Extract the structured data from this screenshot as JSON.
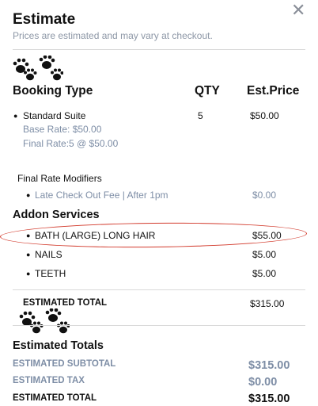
{
  "dialog": {
    "title": "Estimate",
    "subtitle": "Prices are estimated and may vary at checkout.",
    "close_icon": "close-icon"
  },
  "booking": {
    "headers": {
      "type": "Booking Type",
      "qty": "QTY",
      "price": "Est.Price"
    },
    "item": {
      "name": "Standard Suite",
      "qty": "5",
      "price": "$50.00",
      "base_rate": "Base Rate: $50.00",
      "final_rate": "Final Rate:5 @ $50.00"
    },
    "modifiers_title": "Final Rate Modifiers",
    "modifiers": [
      {
        "label": "Late Check Out Fee | After 1pm",
        "price": "$0.00"
      }
    ]
  },
  "addons": {
    "title": "Addon Services",
    "items": [
      {
        "name": "BATH (LARGE) LONG HAIR",
        "price": "$55.00",
        "highlighted": true
      },
      {
        "name": "NAILS",
        "price": "$5.00"
      },
      {
        "name": "TEETH",
        "price": "$5.00"
      }
    ]
  },
  "estimated_total": {
    "label": "ESTIMATED TOTAL",
    "value": "$315.00"
  },
  "totals": {
    "title": "Estimated Totals",
    "subtotal_label": "ESTIMATED SUBTOTAL",
    "subtotal_value": "$315.00",
    "tax_label": "ESTIMATED TAX",
    "tax_value": "$0.00",
    "total_label": "ESTIMATED TOTAL",
    "total_value": "$315.00"
  },
  "icons": {
    "paw": "paw-prints-icon",
    "bullet": "bullet-icon"
  },
  "colors": {
    "muted_text": "#7e8ea6",
    "highlight_circle": "#d23a2c"
  }
}
